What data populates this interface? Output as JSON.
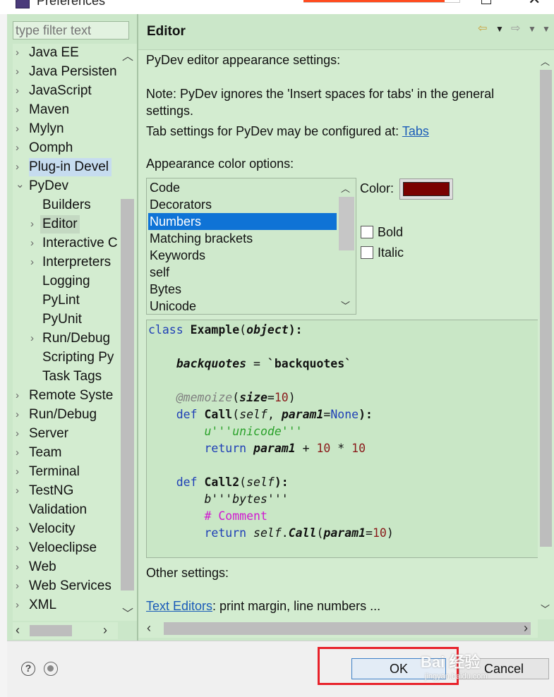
{
  "window": {
    "title": "Preferences"
  },
  "filter": {
    "placeholder": "type filter text"
  },
  "tree": {
    "items": [
      {
        "label": "Java EE",
        "expander": "›"
      },
      {
        "label": "Java Persisten",
        "expander": "›"
      },
      {
        "label": "JavaScript",
        "expander": "›"
      },
      {
        "label": "Maven",
        "expander": "›"
      },
      {
        "label": "Mylyn",
        "expander": "›"
      },
      {
        "label": "Oomph",
        "expander": "›"
      },
      {
        "label": "Plug-in Devel",
        "expander": "›"
      },
      {
        "label": "PyDev",
        "expander": "⌄"
      },
      {
        "label": "Builders",
        "expander": ""
      },
      {
        "label": "Editor",
        "expander": "›"
      },
      {
        "label": "Interactive C",
        "expander": "›"
      },
      {
        "label": "Interpreters",
        "expander": "›"
      },
      {
        "label": "Logging",
        "expander": ""
      },
      {
        "label": "PyLint",
        "expander": ""
      },
      {
        "label": "PyUnit",
        "expander": ""
      },
      {
        "label": "Run/Debug",
        "expander": "›"
      },
      {
        "label": "Scripting Py",
        "expander": ""
      },
      {
        "label": "Task Tags",
        "expander": ""
      },
      {
        "label": "Remote Syste",
        "expander": "›"
      },
      {
        "label": "Run/Debug",
        "expander": "›"
      },
      {
        "label": "Server",
        "expander": "›"
      },
      {
        "label": "Team",
        "expander": "›"
      },
      {
        "label": "Terminal",
        "expander": "›"
      },
      {
        "label": "TestNG",
        "expander": "›"
      },
      {
        "label": "Validation",
        "expander": ""
      },
      {
        "label": "Velocity",
        "expander": "›"
      },
      {
        "label": "Veloeclipse",
        "expander": "›"
      },
      {
        "label": "Web",
        "expander": "›"
      },
      {
        "label": "Web Services",
        "expander": "›"
      },
      {
        "label": "XML",
        "expander": "›"
      }
    ]
  },
  "editor": {
    "page_title": "Editor",
    "intro": "PyDev editor appearance settings:",
    "note_line1": "Note: PyDev ignores the 'Insert spaces for tabs' in the general",
    "note_line2": "settings.",
    "tab_settings_prefix": "Tab settings for PyDev may be configured at: ",
    "tab_settings_link": "Tabs",
    "appearance_label": "Appearance color options:",
    "color_options": [
      "Code",
      "Decorators",
      "Numbers",
      "Matching brackets",
      "Keywords",
      "self",
      "Bytes",
      "Unicode"
    ],
    "selected_option": "Numbers",
    "color_label": "Color:",
    "color_value": "#7a0000",
    "bold_label": "Bold",
    "italic_label": "Italic",
    "other_settings": "Other settings:",
    "text_editors_link": "Text Editors",
    "text_editors_suffix": ": print margin, line numbers ..."
  },
  "code": {
    "l1_kw": "class",
    "l1_name": "Example",
    "l1_arg": "object",
    "l3_name": "backquotes",
    "l3_str": "`backquotes`",
    "l5_deco": "@memoize",
    "l5_arg": "size",
    "l5_num": "10",
    "l6_kw": "def",
    "l6_name": "Call",
    "l6_self": "self",
    "l6_param": "param1",
    "l6_none": "None",
    "l7_str": "u'''unicode'''",
    "l8_kw": "return",
    "l8_param": "param1",
    "l8_num1": "10",
    "l8_num2": "10",
    "l10_kw": "def",
    "l10_name": "Call2",
    "l10_self": "self",
    "l11_bytes": "b'''bytes'''",
    "l12_comment": "# Comment",
    "l13_kw": "return",
    "l13_self": "self",
    "l13_call": "Call",
    "l13_param": "param1",
    "l13_num": "10"
  },
  "buttons": {
    "ok": "OK",
    "cancel": "Cancel"
  },
  "watermark": {
    "line1": "Bai 经验",
    "line2": "jingyan.baidu.com"
  },
  "colors": {
    "selection": "#0f73d6",
    "panel_bg": "#cbe7c9",
    "highlight_box": "#e8212a"
  }
}
